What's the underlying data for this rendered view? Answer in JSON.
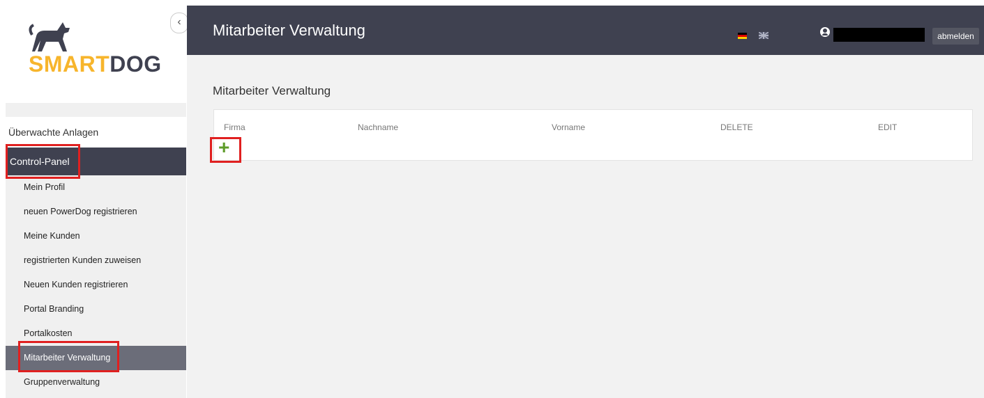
{
  "brand": {
    "logo_part1": "SMART",
    "logo_part2": "DOG",
    "accent_color": "#f7b52c",
    "dark_color": "#3f4150"
  },
  "sidebar": {
    "collapse_icon": "chevron-left-icon",
    "collapse_glyph": "‹",
    "top_item": "Überwachte Anlagen",
    "section_label": "Control-Panel",
    "items": [
      {
        "label": "Mein Profil"
      },
      {
        "label": "neuen PowerDog registrieren"
      },
      {
        "label": "Meine Kunden"
      },
      {
        "label": "registrierten Kunden zuweisen"
      },
      {
        "label": "Neuen Kunden registrieren"
      },
      {
        "label": "Portal Branding"
      },
      {
        "label": "Portalkosten"
      },
      {
        "label": "Mitarbeiter Verwaltung",
        "active": true
      },
      {
        "label": "Gruppenverwaltung"
      }
    ]
  },
  "header": {
    "title": "Mitarbeiter Verwaltung",
    "user_icon": "user-circle-icon",
    "username": "",
    "logout_label": "abmelden",
    "languages": [
      "de",
      "en"
    ]
  },
  "main": {
    "page_title": "Mitarbeiter Verwaltung",
    "table": {
      "columns": [
        "Firma",
        "Nachname",
        "Vorname",
        "DELETE",
        "EDIT"
      ],
      "rows": []
    },
    "add_glyph": "+",
    "add_icon": "plus-icon",
    "add_color": "#5e9c2a"
  },
  "annotation_color": "#e02020"
}
